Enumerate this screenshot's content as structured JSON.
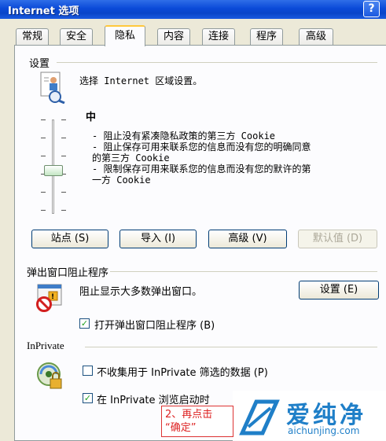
{
  "window": {
    "title": "Internet 选项",
    "help_label": "?"
  },
  "tabs": [
    {
      "label": "常规"
    },
    {
      "label": "安全"
    },
    {
      "label": "隐私",
      "active": true
    },
    {
      "label": "内容"
    },
    {
      "label": "连接"
    },
    {
      "label": "程序"
    },
    {
      "label": "高级"
    }
  ],
  "settings": {
    "group_title": "设置",
    "zone_prompt": "选择 Internet 区域设置。",
    "level": "中",
    "description_lines": [
      "- 阻止没有紧凑隐私政策的第三方 Cookie",
      "- 阻止保存可用来联系您的信息而没有您的明确同意",
      "的第三方 Cookie",
      "- 限制保存可用来联系您的信息而没有您的默许的第",
      "一方 Cookie"
    ],
    "buttons": {
      "sites": "站点 (S)",
      "import": "导入 (I)",
      "advanced": "高级 (V)",
      "default": "默认值 (D)"
    }
  },
  "popup": {
    "group_title": "弹出窗口阻止程序",
    "status_text": "阻止显示大多数弹出窗口。",
    "settings_button": "设置 (E)",
    "enable_checkbox": {
      "label": "打开弹出窗口阻止程序 (B)",
      "checked": true
    }
  },
  "inprivate": {
    "group_title": "InPrivate",
    "no_collect": {
      "label": "不收集用于 InPrivate 筛选的数据 (P)",
      "checked": false
    },
    "disable_toolbars": {
      "label": "在 InPrivate 浏览启动时",
      "checked": true
    }
  },
  "annotation": {
    "line1": "2、再点击",
    "line2": "“确定”"
  },
  "watermark": {
    "main": "爱纯净",
    "url": "aichunjing.com"
  },
  "colors": {
    "titlebar": "#0a4ad8",
    "annotation": "#d22222",
    "watermark": "#1f7fc8"
  }
}
